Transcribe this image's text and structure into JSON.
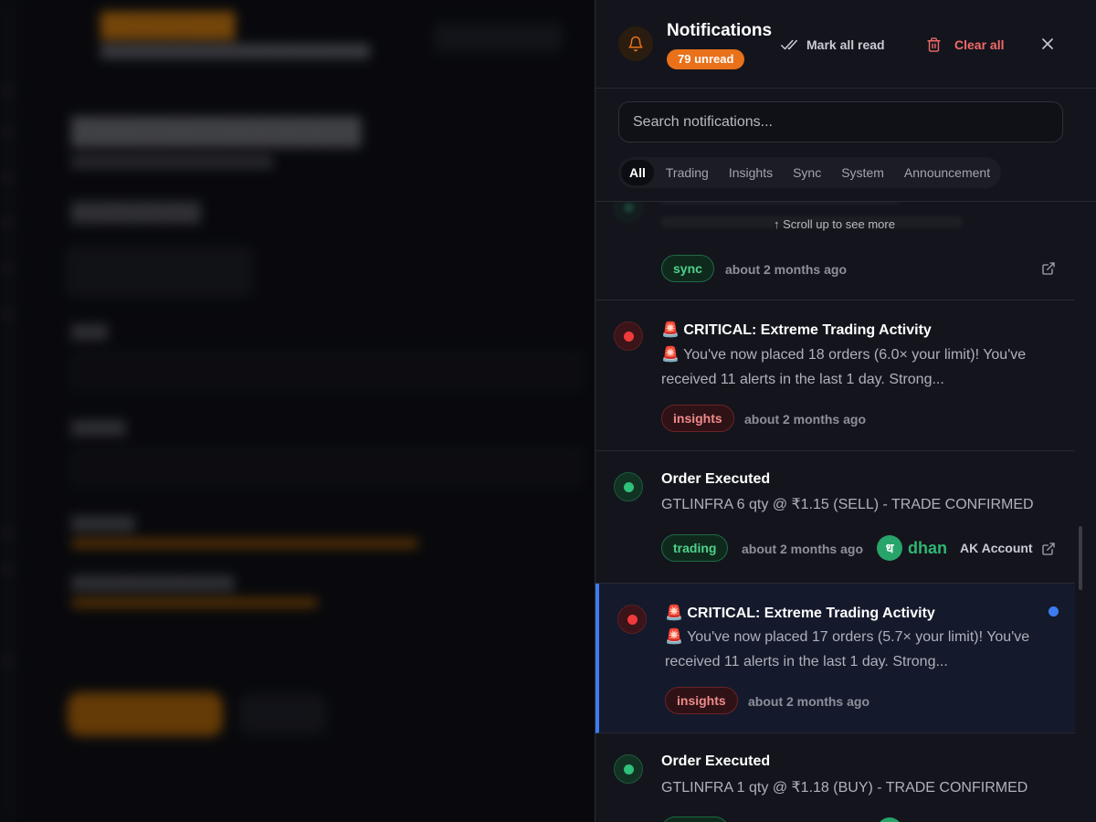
{
  "panel": {
    "title": "Notifications",
    "unread_badge": "79 unread",
    "mark_all_read": "Mark all read",
    "clear_all": "Clear all",
    "search_placeholder": "Search notifications...",
    "tabs": [
      {
        "label": "All",
        "active": true
      },
      {
        "label": "Trading"
      },
      {
        "label": "Insights"
      },
      {
        "label": "Sync"
      },
      {
        "label": "System"
      },
      {
        "label": "Announcement"
      }
    ],
    "scroll_hint": "↑ Scroll up to see more",
    "notifications": [
      {
        "status": "green",
        "tag": "sync",
        "time": "about 2 months ago",
        "has_link": true
      },
      {
        "status": "red",
        "title": "🚨 CRITICAL: Extreme Trading Activity",
        "body": "🚨 You've now placed 18 orders (6.0× your limit)! You've received 11 alerts in the last 1 day. Strong...",
        "tag": "insights",
        "time": "about 2 months ago"
      },
      {
        "status": "green",
        "title": "Order Executed",
        "body": "GTLINFRA 6 qty @ ₹1.15 (SELL) - TRADE CONFIRMED",
        "tag": "trading",
        "time": "about 2 months ago",
        "broker_logo": "ध",
        "broker": "dhan",
        "account": "AK Account",
        "has_link": true
      },
      {
        "status": "red",
        "unread": true,
        "title": "🚨 CRITICAL: Extreme Trading Activity",
        "body": "🚨 You've now placed 17 orders (5.7× your limit)! You've received 11 alerts in the last 1 day. Strong...",
        "tag": "insights",
        "time": "about 2 months ago"
      },
      {
        "status": "green",
        "title": "Order Executed",
        "body": "GTLINFRA 1 qty @ ₹1.18 (BUY) - TRADE CONFIRMED"
      }
    ]
  },
  "colors": {
    "accent_orange": "#e8711a",
    "danger": "#f06a6a",
    "unread_blue": "#3d7cf0",
    "success": "#2fc07a"
  }
}
